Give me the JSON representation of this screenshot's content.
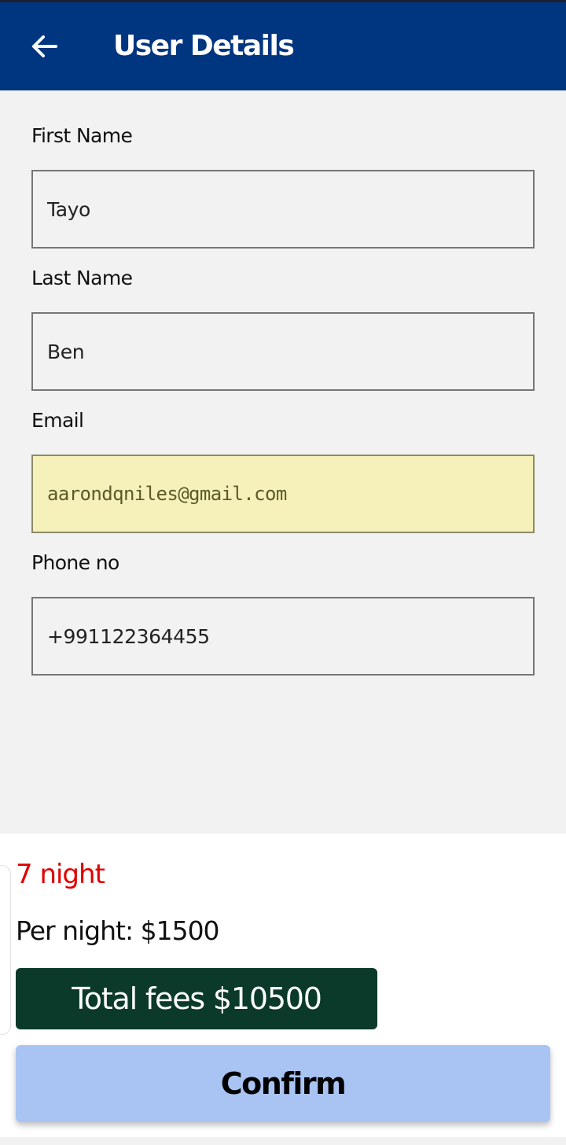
{
  "app_bar": {
    "title": "User Details",
    "back_icon": "arrow-left-icon",
    "background": "#003580"
  },
  "form": {
    "first_name": {
      "label": "First Name",
      "value": "Tayo"
    },
    "last_name": {
      "label": "Last Name",
      "value": "Ben"
    },
    "email": {
      "label": "Email",
      "value": "aarondqniles@gmail.com"
    },
    "phone": {
      "label": "Phone no",
      "value": "+991122364455"
    }
  },
  "summary": {
    "nights": "7 night",
    "per_night": "Per night: $1500",
    "total": "Total fees $10500"
  },
  "actions": {
    "confirm_label": "Confirm"
  },
  "colors": {
    "accent_red": "#e00000",
    "total_badge": "#0b3a2a",
    "confirm_button": "#a9c4f3",
    "autofill": "#f6f1ba"
  }
}
